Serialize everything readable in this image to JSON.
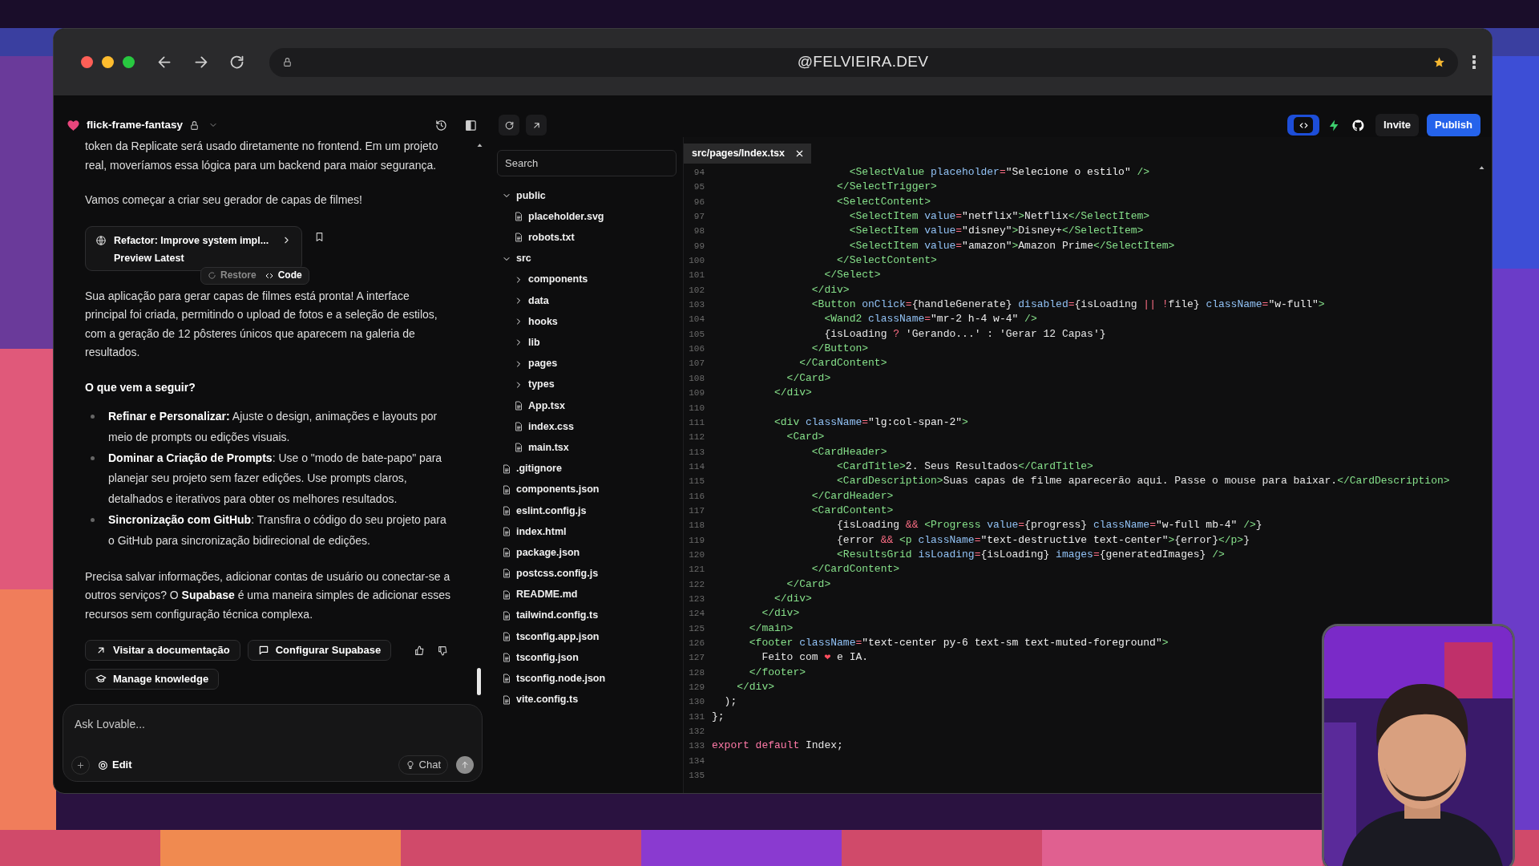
{
  "browser": {
    "address": "@FELVIEIRA.DEV"
  },
  "toolbar": {
    "project": "flick-frame-fantasy",
    "code_view": {
      "selected": true
    },
    "invite": "Invite",
    "publish": "Publish"
  },
  "chat": {
    "blocks": [
      {
        "kind": "paragraph",
        "text": "token da Replicate será usado diretamente no frontend. Em um projeto real, moveríamos essa lógica para um backend para maior segurança."
      },
      {
        "kind": "paragraph",
        "text": "Vamos começar a criar seu gerador de capas de filmes!"
      },
      {
        "kind": "version_card",
        "title": "Refactor: Improve system impl...",
        "subtitle": "Preview Latest",
        "restore": "Restore",
        "code": "Code"
      },
      {
        "kind": "paragraph",
        "text": "Sua aplicação para gerar capas de filmes está pronta! A interface principal foi criada, permitindo o upload de fotos e a seleção de estilos, com a geração de 12 pôsteres únicos que aparecem na galeria de resultados."
      },
      {
        "kind": "heading",
        "text": "O que vem a seguir?"
      },
      {
        "kind": "bullets",
        "items": [
          "**Refinar e Personalizar:** Ajuste o design, animações e layouts por meio de prompts ou edições visuais.",
          "**Dominar a Criação de Prompts**: Use o \"modo de bate-papo\" para planejar seu projeto sem fazer edições. Use prompts claros, detalhados e iterativos para obter os melhores resultados.",
          "**Sincronização com GitHub**: Transfira o código do seu projeto para o GitHub para sincronização bidirecional de edições."
        ]
      },
      {
        "kind": "paragraph",
        "text": "Precisa salvar informações, adicionar contas de usuário ou conectar-se a outros serviços? O **Supabase** é uma maneira simples de adicionar esses recursos sem configuração técnica complexa."
      },
      {
        "kind": "actions",
        "buttons": [
          "Visitar a documentação",
          "Configurar Supabase",
          "Manage knowledge"
        ]
      }
    ],
    "input": {
      "placeholder": "Ask Lovable...",
      "edit": "Edit",
      "chat": "Chat"
    }
  },
  "files": {
    "search_placeholder": "Search",
    "tree": [
      {
        "name": "public",
        "kind": "folder",
        "expanded": true,
        "children": [
          {
            "name": "placeholder.svg",
            "kind": "file"
          },
          {
            "name": "robots.txt",
            "kind": "file"
          }
        ]
      },
      {
        "name": "src",
        "kind": "folder",
        "expanded": true,
        "children": [
          {
            "name": "components",
            "kind": "folder",
            "expanded": false
          },
          {
            "name": "data",
            "kind": "folder",
            "expanded": false
          },
          {
            "name": "hooks",
            "kind": "folder",
            "expanded": false
          },
          {
            "name": "lib",
            "kind": "folder",
            "expanded": false
          },
          {
            "name": "pages",
            "kind": "folder",
            "expanded": false
          },
          {
            "name": "types",
            "kind": "folder",
            "expanded": false
          },
          {
            "name": "App.tsx",
            "kind": "file"
          },
          {
            "name": "index.css",
            "kind": "file"
          },
          {
            "name": "main.tsx",
            "kind": "file"
          }
        ]
      },
      {
        "name": ".gitignore",
        "kind": "file"
      },
      {
        "name": "components.json",
        "kind": "file"
      },
      {
        "name": "eslint.config.js",
        "kind": "file"
      },
      {
        "name": "index.html",
        "kind": "file"
      },
      {
        "name": "package.json",
        "kind": "file"
      },
      {
        "name": "postcss.config.js",
        "kind": "file"
      },
      {
        "name": "README.md",
        "kind": "file"
      },
      {
        "name": "tailwind.config.ts",
        "kind": "file"
      },
      {
        "name": "tsconfig.app.json",
        "kind": "file"
      },
      {
        "name": "tsconfig.json",
        "kind": "file"
      },
      {
        "name": "tsconfig.node.json",
        "kind": "file"
      },
      {
        "name": "vite.config.ts",
        "kind": "file"
      }
    ]
  },
  "editor": {
    "tab": "src/pages/Index.tsx",
    "lines": [
      {
        "number": "94",
        "tokens": [
          {
            "kind": "tag",
            "text": "                      <SelectValue"
          },
          {
            "kind": "attr",
            "text": " placeholder"
          },
          {
            "kind": "op",
            "text": "="
          },
          {
            "kind": "string",
            "text": "\"Selecione o estilo\""
          },
          {
            "kind": "tag",
            "text": " />"
          }
        ]
      },
      {
        "number": "95",
        "tokens": [
          {
            "kind": "tag",
            "text": "                    </SelectTrigger>"
          }
        ]
      },
      {
        "number": "96",
        "tokens": [
          {
            "kind": "tag",
            "text": "                    <SelectContent>"
          }
        ]
      },
      {
        "number": "97",
        "tokens": [
          {
            "kind": "tag",
            "text": "                      <SelectItem"
          },
          {
            "kind": "attr",
            "text": " value"
          },
          {
            "kind": "op",
            "text": "="
          },
          {
            "kind": "string",
            "text": "\"netflix\""
          },
          {
            "kind": "tag",
            "text": ">"
          },
          {
            "kind": "text",
            "text": "Netflix"
          },
          {
            "kind": "tag",
            "text": "</SelectItem>"
          }
        ]
      },
      {
        "number": "98",
        "tokens": [
          {
            "kind": "tag",
            "text": "                      <SelectItem"
          },
          {
            "kind": "attr",
            "text": " value"
          },
          {
            "kind": "op",
            "text": "="
          },
          {
            "kind": "string",
            "text": "\"disney\""
          },
          {
            "kind": "tag",
            "text": ">"
          },
          {
            "kind": "text",
            "text": "Disney+"
          },
          {
            "kind": "tag",
            "text": "</SelectItem>"
          }
        ]
      },
      {
        "number": "99",
        "tokens": [
          {
            "kind": "tag",
            "text": "                      <SelectItem"
          },
          {
            "kind": "attr",
            "text": " value"
          },
          {
            "kind": "op",
            "text": "="
          },
          {
            "kind": "string",
            "text": "\"amazon\""
          },
          {
            "kind": "tag",
            "text": ">"
          },
          {
            "kind": "text",
            "text": "Amazon Prime"
          },
          {
            "kind": "tag",
            "text": "</SelectItem>"
          }
        ]
      },
      {
        "number": "100",
        "tokens": [
          {
            "kind": "tag",
            "text": "                    </SelectContent>"
          }
        ]
      },
      {
        "number": "101",
        "tokens": [
          {
            "kind": "tag",
            "text": "                  </Select>"
          }
        ]
      },
      {
        "number": "102",
        "tokens": [
          {
            "kind": "tag",
            "text": "                </div>"
          }
        ]
      },
      {
        "number": "103",
        "tokens": [
          {
            "kind": "tag",
            "text": "                <Button"
          },
          {
            "kind": "attr",
            "text": " onClick"
          },
          {
            "kind": "op",
            "text": "="
          },
          {
            "kind": "text",
            "text": "{handleGenerate} "
          },
          {
            "kind": "attr",
            "text": "disabled"
          },
          {
            "kind": "op",
            "text": "="
          },
          {
            "kind": "text",
            "text": "{isLoading "
          },
          {
            "kind": "op",
            "text": "|| !"
          },
          {
            "kind": "text",
            "text": "file} "
          },
          {
            "kind": "attr",
            "text": "className"
          },
          {
            "kind": "op",
            "text": "="
          },
          {
            "kind": "string",
            "text": "\"w-full\""
          },
          {
            "kind": "tag",
            "text": ">"
          }
        ]
      },
      {
        "number": "104",
        "tokens": [
          {
            "kind": "tag",
            "text": "                  <Wand2"
          },
          {
            "kind": "attr",
            "text": " className"
          },
          {
            "kind": "op",
            "text": "="
          },
          {
            "kind": "string",
            "text": "\"mr-2 h-4 w-4\""
          },
          {
            "kind": "tag",
            "text": " />"
          }
        ]
      },
      {
        "number": "105",
        "tokens": [
          {
            "kind": "text",
            "text": "                  {isLoading "
          },
          {
            "kind": "op",
            "text": "?"
          },
          {
            "kind": "text",
            "text": " 'Gerando...' : 'Gerar 12 Capas'}"
          }
        ]
      },
      {
        "number": "106",
        "tokens": [
          {
            "kind": "tag",
            "text": "                </Button>"
          }
        ]
      },
      {
        "number": "107",
        "tokens": [
          {
            "kind": "tag",
            "text": "              </CardContent>"
          }
        ]
      },
      {
        "number": "108",
        "tokens": [
          {
            "kind": "tag",
            "text": "            </Card>"
          }
        ]
      },
      {
        "number": "109",
        "tokens": [
          {
            "kind": "tag",
            "text": "          </div>"
          }
        ]
      },
      {
        "number": "110"
      },
      {
        "number": "111",
        "tokens": [
          {
            "kind": "tag",
            "text": "          <div"
          },
          {
            "kind": "attr",
            "text": " className"
          },
          {
            "kind": "op",
            "text": "="
          },
          {
            "kind": "string",
            "text": "\"lg:col-span-2\""
          },
          {
            "kind": "tag",
            "text": ">"
          }
        ]
      },
      {
        "number": "112",
        "tokens": [
          {
            "kind": "tag",
            "text": "            <Card>"
          }
        ]
      },
      {
        "number": "113",
        "tokens": [
          {
            "kind": "tag",
            "text": "                <CardHeader>"
          }
        ]
      },
      {
        "number": "114",
        "tokens": [
          {
            "kind": "tag",
            "text": "                    <CardTitle>"
          },
          {
            "kind": "text",
            "text": "2. Seus Resultados"
          },
          {
            "kind": "tag",
            "text": "</CardTitle>"
          }
        ]
      },
      {
        "number": "115",
        "tokens": [
          {
            "kind": "tag",
            "text": "                    <CardDescription>"
          },
          {
            "kind": "text",
            "text": "Suas capas de filme aparecerão aqui. Passe o mouse para baixar."
          },
          {
            "kind": "tag",
            "text": "</CardDescription>"
          }
        ]
      },
      {
        "number": "116",
        "tokens": [
          {
            "kind": "tag",
            "text": "                </CardHeader>"
          }
        ]
      },
      {
        "number": "117",
        "tokens": [
          {
            "kind": "tag",
            "text": "                <CardContent>"
          }
        ]
      },
      {
        "number": "118",
        "tokens": [
          {
            "kind": "text",
            "text": "                    {isLoading "
          },
          {
            "kind": "op",
            "text": "&&"
          },
          {
            "kind": "tag",
            "text": " <Progress"
          },
          {
            "kind": "attr",
            "text": " value"
          },
          {
            "kind": "op",
            "text": "="
          },
          {
            "kind": "text",
            "text": "{progress} "
          },
          {
            "kind": "attr",
            "text": "className"
          },
          {
            "kind": "op",
            "text": "="
          },
          {
            "kind": "string",
            "text": "\"w-full mb-4\""
          },
          {
            "kind": "tag",
            "text": " />"
          },
          {
            "kind": "text",
            "text": "}"
          }
        ]
      },
      {
        "number": "119",
        "tokens": [
          {
            "kind": "text",
            "text": "                    {error "
          },
          {
            "kind": "op",
            "text": "&&"
          },
          {
            "kind": "tag",
            "text": " <p"
          },
          {
            "kind": "attr",
            "text": " className"
          },
          {
            "kind": "op",
            "text": "="
          },
          {
            "kind": "string",
            "text": "\"text-destructive text-center\""
          },
          {
            "kind": "tag",
            "text": ">"
          },
          {
            "kind": "text",
            "text": "{error}"
          },
          {
            "kind": "tag",
            "text": "</p>"
          },
          {
            "kind": "text",
            "text": "}"
          }
        ]
      },
      {
        "number": "120",
        "tokens": [
          {
            "kind": "tag",
            "text": "                    <ResultsGrid"
          },
          {
            "kind": "attr",
            "text": " isLoading"
          },
          {
            "kind": "op",
            "text": "="
          },
          {
            "kind": "text",
            "text": "{isLoading} "
          },
          {
            "kind": "attr",
            "text": "images"
          },
          {
            "kind": "op",
            "text": "="
          },
          {
            "kind": "text",
            "text": "{generatedImages} "
          },
          {
            "kind": "tag",
            "text": "/>"
          }
        ]
      },
      {
        "number": "121",
        "tokens": [
          {
            "kind": "tag",
            "text": "                </CardContent>"
          }
        ]
      },
      {
        "number": "122",
        "tokens": [
          {
            "kind": "tag",
            "text": "            </Card>"
          }
        ]
      },
      {
        "number": "123",
        "tokens": [
          {
            "kind": "tag",
            "text": "          </div>"
          }
        ]
      },
      {
        "number": "124",
        "tokens": [
          {
            "kind": "tag",
            "text": "        </div>"
          }
        ]
      },
      {
        "number": "125",
        "tokens": [
          {
            "kind": "tag",
            "text": "      </main>"
          }
        ]
      },
      {
        "number": "126",
        "tokens": [
          {
            "kind": "tag",
            "text": "      <footer"
          },
          {
            "kind": "attr",
            "text": " className"
          },
          {
            "kind": "op",
            "text": "="
          },
          {
            "kind": "string",
            "text": "\"text-center py-6 text-sm text-muted-foreground\""
          },
          {
            "kind": "tag",
            "text": ">"
          }
        ]
      },
      {
        "number": "127",
        "tokens": [
          {
            "kind": "text",
            "text": "        Feito com "
          },
          {
            "kind": "heart",
            "text": "❤"
          },
          {
            "kind": "text",
            "text": " e IA."
          }
        ]
      },
      {
        "number": "128",
        "tokens": [
          {
            "kind": "tag",
            "text": "      </footer>"
          }
        ]
      },
      {
        "number": "129",
        "tokens": [
          {
            "kind": "tag",
            "text": "    </div>"
          }
        ]
      },
      {
        "number": "130",
        "tokens": [
          {
            "kind": "text",
            "text": "  );"
          }
        ]
      },
      {
        "number": "131",
        "tokens": [
          {
            "kind": "text",
            "text": "};"
          }
        ]
      },
      {
        "number": "132"
      },
      {
        "number": "133",
        "tokens": [
          {
            "kind": "keyword",
            "text": "export default"
          },
          {
            "kind": "text",
            "text": " Index;"
          }
        ]
      },
      {
        "number": "134"
      },
      {
        "number": "135"
      }
    ]
  }
}
